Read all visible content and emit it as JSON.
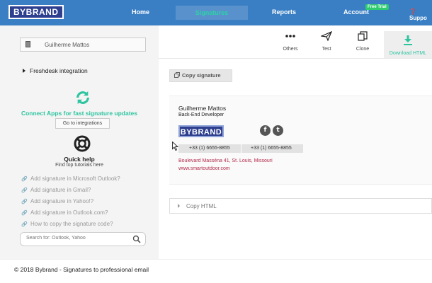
{
  "nav": {
    "logo": "BYBRAND",
    "home": "Home",
    "signatures": "Signatures",
    "reports": "Reports",
    "account": "Account",
    "badge": "Free Trial",
    "support": "Suppo"
  },
  "sidebar": {
    "selected_user": "Guilherme Mattos",
    "integration": "Freshdesk integration",
    "connect_text": "Connect Apps for fast signature updates",
    "goto_button": "Go to integrations",
    "quick_help": "Quick help",
    "find_tutorials": "Find top tutorials here",
    "help_items": [
      {
        "label": "Add signature in Microsoft Outlook?"
      },
      {
        "label": "Add signature in Gmail?"
      },
      {
        "label": "Add signature in Yahoo!?"
      },
      {
        "label": "Add signature in Outlook.com?"
      },
      {
        "label": "How to copy the signature code?"
      }
    ],
    "search_placeholder": "Search for: Outlook, Yahoo"
  },
  "toolbar": {
    "others": "Others",
    "test": "Test",
    "clone": "Clone",
    "download": "Download HTML"
  },
  "main": {
    "copy_signature": "Copy signature",
    "copy_html": "Copy HTML"
  },
  "signature": {
    "name": "Guilherme Mattos",
    "title": "Back-End Developer",
    "logo": "BYBRAND",
    "phone1": "+33 (1) 6655-8855",
    "phone2": "+33 (1) 6655-8855",
    "address": "Boulevard Masséna 41, St. Louis, Missouri",
    "website": "www.smartoutdoor.com",
    "social_fb": "f",
    "social_tw": "t"
  },
  "footer": {
    "text": "© 2018 Bybrand - Signatures to professional email"
  },
  "colors": {
    "nav_bg": "#3a7fc4",
    "accent": "#2ec4a0",
    "brand": "#2e3f8f",
    "address": "#b22a4a"
  }
}
